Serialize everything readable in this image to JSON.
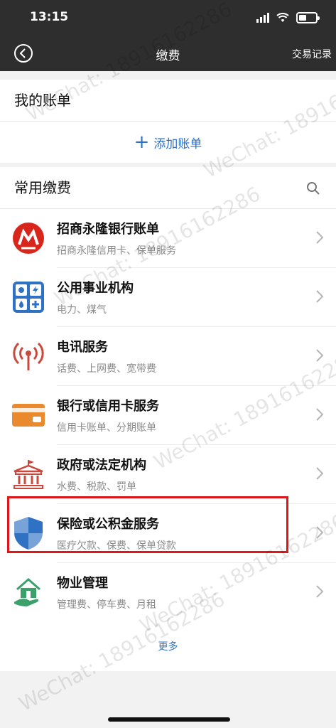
{
  "status": {
    "time": "13:15"
  },
  "nav": {
    "title": "缴费",
    "right": "交易记录"
  },
  "bills": {
    "title": "我的账单",
    "add_label": "添加账单"
  },
  "common": {
    "title": "常用缴费",
    "items": [
      {
        "name": "招商永隆银行账单",
        "desc": "招商永隆信用卡、保单服务",
        "icon": "bank-logo-icon"
      },
      {
        "name": "公用事业机构",
        "desc": "电力、煤气",
        "icon": "utility-icon"
      },
      {
        "name": "电讯服务",
        "desc": "话费、上网费、宽带费",
        "icon": "antenna-icon"
      },
      {
        "name": "银行或信用卡服务",
        "desc": "信用卡账单、分期账单",
        "icon": "credit-card-icon"
      },
      {
        "name": "政府或法定机构",
        "desc": "水费、税款、罚单",
        "icon": "government-building-icon"
      },
      {
        "name": "保险或公积金服务",
        "desc": "医疗欠款、保费、保单贷款",
        "icon": "shield-icon"
      },
      {
        "name": "物业管理",
        "desc": "管理费、停车费、月租",
        "icon": "house-hand-icon"
      }
    ],
    "more_label": "更多"
  },
  "watermark": {
    "text": "WeChat: 18916162286"
  },
  "colors": {
    "accent": "#2f72c4",
    "highlight": "#e01515",
    "bar": "#2e2e2e"
  }
}
